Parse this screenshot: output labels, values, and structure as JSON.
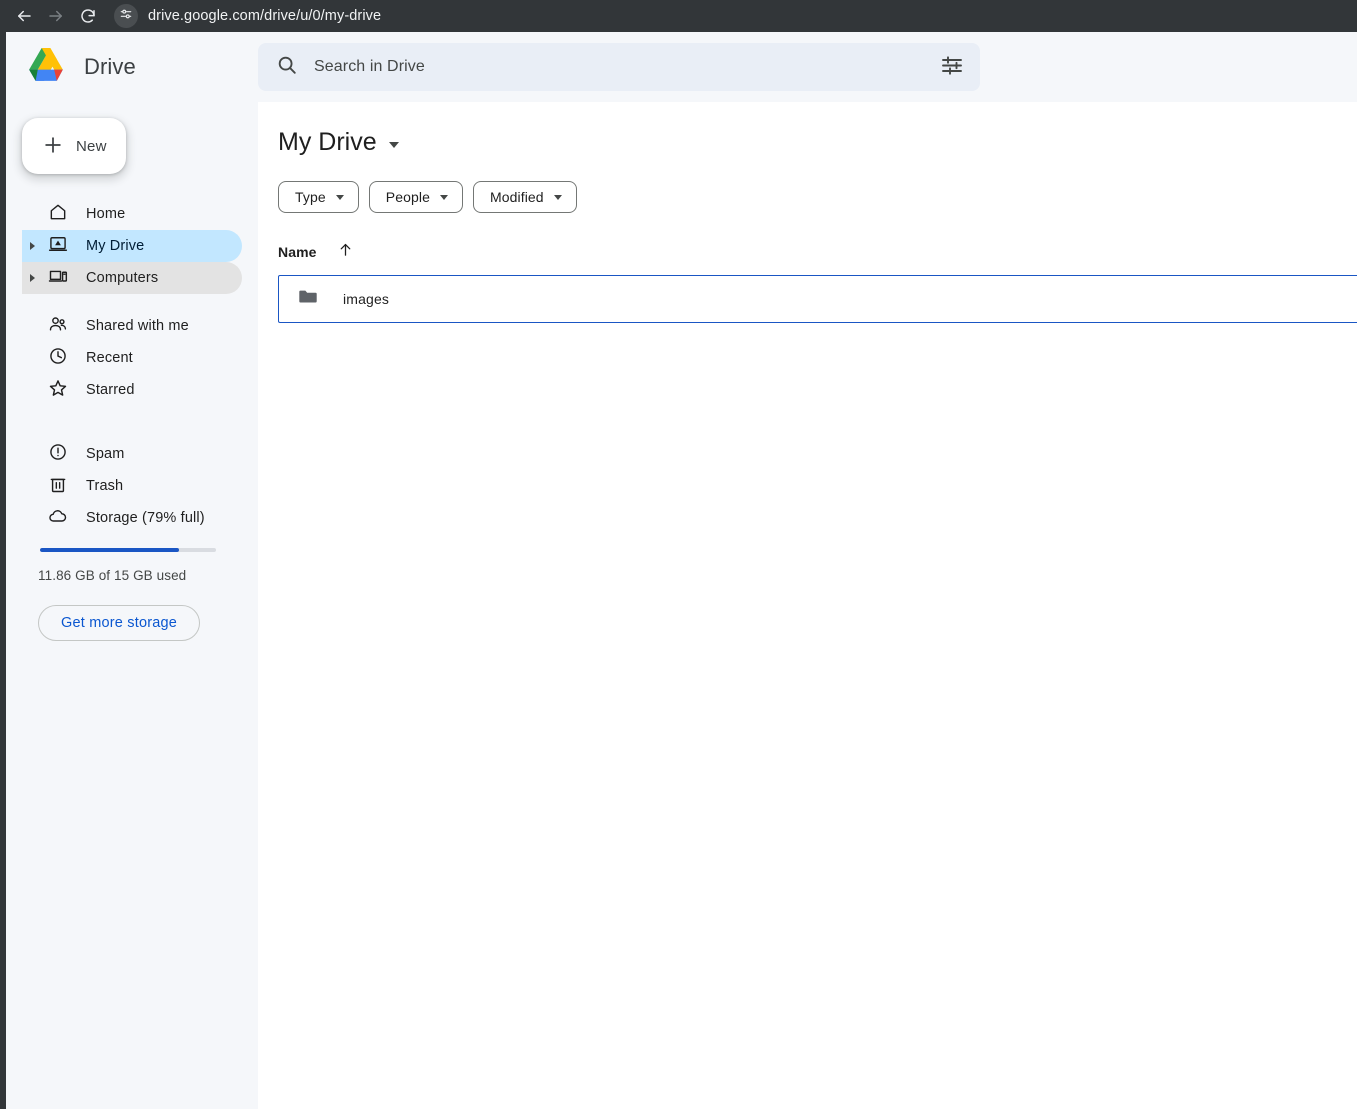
{
  "browser": {
    "back_icon": "arrow-left-icon",
    "forward_icon": "arrow-right-icon",
    "reload_icon": "reload-icon",
    "site_settings_icon": "site-settings-icon",
    "url": "drive.google.com/drive/u/0/my-drive"
  },
  "header": {
    "logo_icon": "google-drive-logo",
    "app_name": "Drive",
    "search": {
      "search_icon": "search-icon",
      "placeholder": "Search in Drive",
      "value": "",
      "tune_icon": "tune-icon"
    }
  },
  "sidebar": {
    "new_button": {
      "label": "New",
      "icon": "plus-icon"
    },
    "groups": [
      {
        "items": [
          {
            "label": "Home",
            "icon": "home-icon",
            "state": "normal",
            "expandable": false
          },
          {
            "label": "My Drive",
            "icon": "my-drive-icon",
            "state": "selected",
            "expandable": true
          },
          {
            "label": "Computers",
            "icon": "computer-icon",
            "state": "hovered",
            "expandable": true
          }
        ]
      },
      {
        "items": [
          {
            "label": "Shared with me",
            "icon": "people-icon",
            "state": "normal",
            "expandable": false
          },
          {
            "label": "Recent",
            "icon": "clock-icon",
            "state": "normal",
            "expandable": false
          },
          {
            "label": "Starred",
            "icon": "star-icon",
            "state": "normal",
            "expandable": false
          }
        ]
      },
      {
        "items": [
          {
            "label": "Spam",
            "icon": "spam-icon",
            "state": "normal",
            "expandable": false
          },
          {
            "label": "Trash",
            "icon": "trash-icon",
            "state": "normal",
            "expandable": false
          },
          {
            "label": "Storage (79% full)",
            "icon": "cloud-icon",
            "state": "normal",
            "expandable": false
          }
        ]
      }
    ],
    "storage": {
      "label": "Storage (79% full)",
      "percent": 79,
      "usage_text": "11.86 GB of 15 GB used",
      "cta_label": "Get more storage"
    }
  },
  "main": {
    "title": "My Drive",
    "title_caret_icon": "chevron-down-icon",
    "filter_chips": [
      {
        "label": "Type",
        "caret_icon": "chevron-down-icon"
      },
      {
        "label": "People",
        "caret_icon": "chevron-down-icon"
      },
      {
        "label": "Modified",
        "caret_icon": "chevron-down-icon"
      }
    ],
    "columns": [
      {
        "label": "Name",
        "sort_icon": "arrow-up-icon",
        "sort_direction": "ascending"
      }
    ],
    "rows": [
      {
        "name": "images",
        "icon": "folder-icon",
        "type": "folder",
        "selected": true
      }
    ]
  },
  "colors": {
    "accent_blue": "#1a56c4",
    "selected_pill": "#c2e7ff",
    "hover_pill": "#e3e3e3",
    "sidebar_bg": "#f5f7fa",
    "search_bg": "#e9eef6",
    "link_blue": "#0b57d0",
    "chrome_bg": "#323639"
  }
}
